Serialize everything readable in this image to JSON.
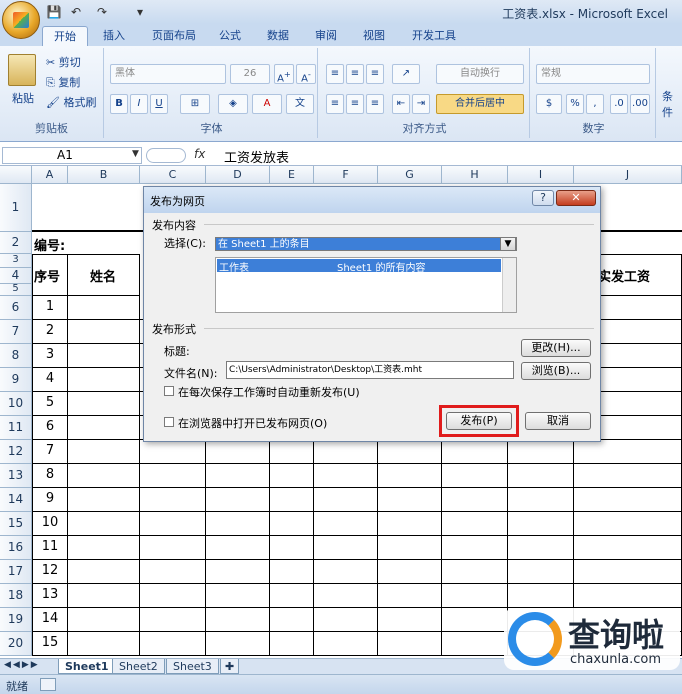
{
  "window": {
    "title": "工资表.xlsx - Microsoft Excel"
  },
  "tabs": [
    "开始",
    "插入",
    "页面布局",
    "公式",
    "数据",
    "审阅",
    "视图",
    "开发工具"
  ],
  "ribbon": {
    "clipboard": {
      "label": "剪贴板",
      "paste": "粘贴",
      "cut": "剪切",
      "copy": "复制",
      "format_painter": "格式刷"
    },
    "font": {
      "label": "字体",
      "name": "黑体",
      "size": "26"
    },
    "alignment": {
      "label": "对齐方式",
      "wrap": "自动换行",
      "merge": "合并后居中"
    },
    "number": {
      "label": "数字",
      "format": "常规"
    },
    "styles": {
      "label": "条件"
    }
  },
  "formula_bar": {
    "name_box": "A1",
    "fx": "fx",
    "content": "工资发放表"
  },
  "columns": [
    "A",
    "B",
    "C",
    "D",
    "E",
    "F",
    "G",
    "H",
    "I",
    "J"
  ],
  "sheet": {
    "serial_label": "编号:",
    "header": {
      "no": "序号",
      "name": "姓名",
      "actual_pay": "实发工资"
    },
    "rows": [
      "1",
      "2",
      "3",
      "4",
      "5",
      "6",
      "7",
      "8",
      "9",
      "10",
      "11",
      "12",
      "13",
      "14",
      "15"
    ],
    "row_numbers": [
      "1",
      "2",
      "3",
      "4",
      "5",
      "6",
      "7",
      "8",
      "9",
      "10",
      "11",
      "12",
      "13",
      "14",
      "15",
      "16",
      "17",
      "18",
      "19",
      "20"
    ]
  },
  "sheet_tabs": [
    "Sheet1",
    "Sheet2",
    "Sheet3"
  ],
  "status": {
    "ready": "就绪"
  },
  "dialog": {
    "title": "发布为网页",
    "help": "?",
    "close": "✕",
    "content_section": "发布内容",
    "select_label": "选择(C):",
    "select_value": "在 Sheet1 上的条目",
    "list_item_left": "工作表",
    "list_item_right": "Sheet1 的所有内容",
    "format_section": "发布形式",
    "title_label": "标题:",
    "change_button": "更改(H)...",
    "filename_label": "文件名(N):",
    "filename_value": "C:\\Users\\Administrator\\Desktop\\工资表.mht",
    "browse_button": "浏览(B)...",
    "auto_republish": "在每次保存工作簿时自动重新发布(U)",
    "open_in_browser": "在浏览器中打开已发布网页(O)",
    "publish_button": "发布(P)",
    "cancel_button": "取消"
  },
  "watermark": {
    "brand": "查询啦",
    "url": "chaxunla.com"
  },
  "colors": {
    "highlight_border": "#e01b1b",
    "selection": "#3d7fd8"
  }
}
